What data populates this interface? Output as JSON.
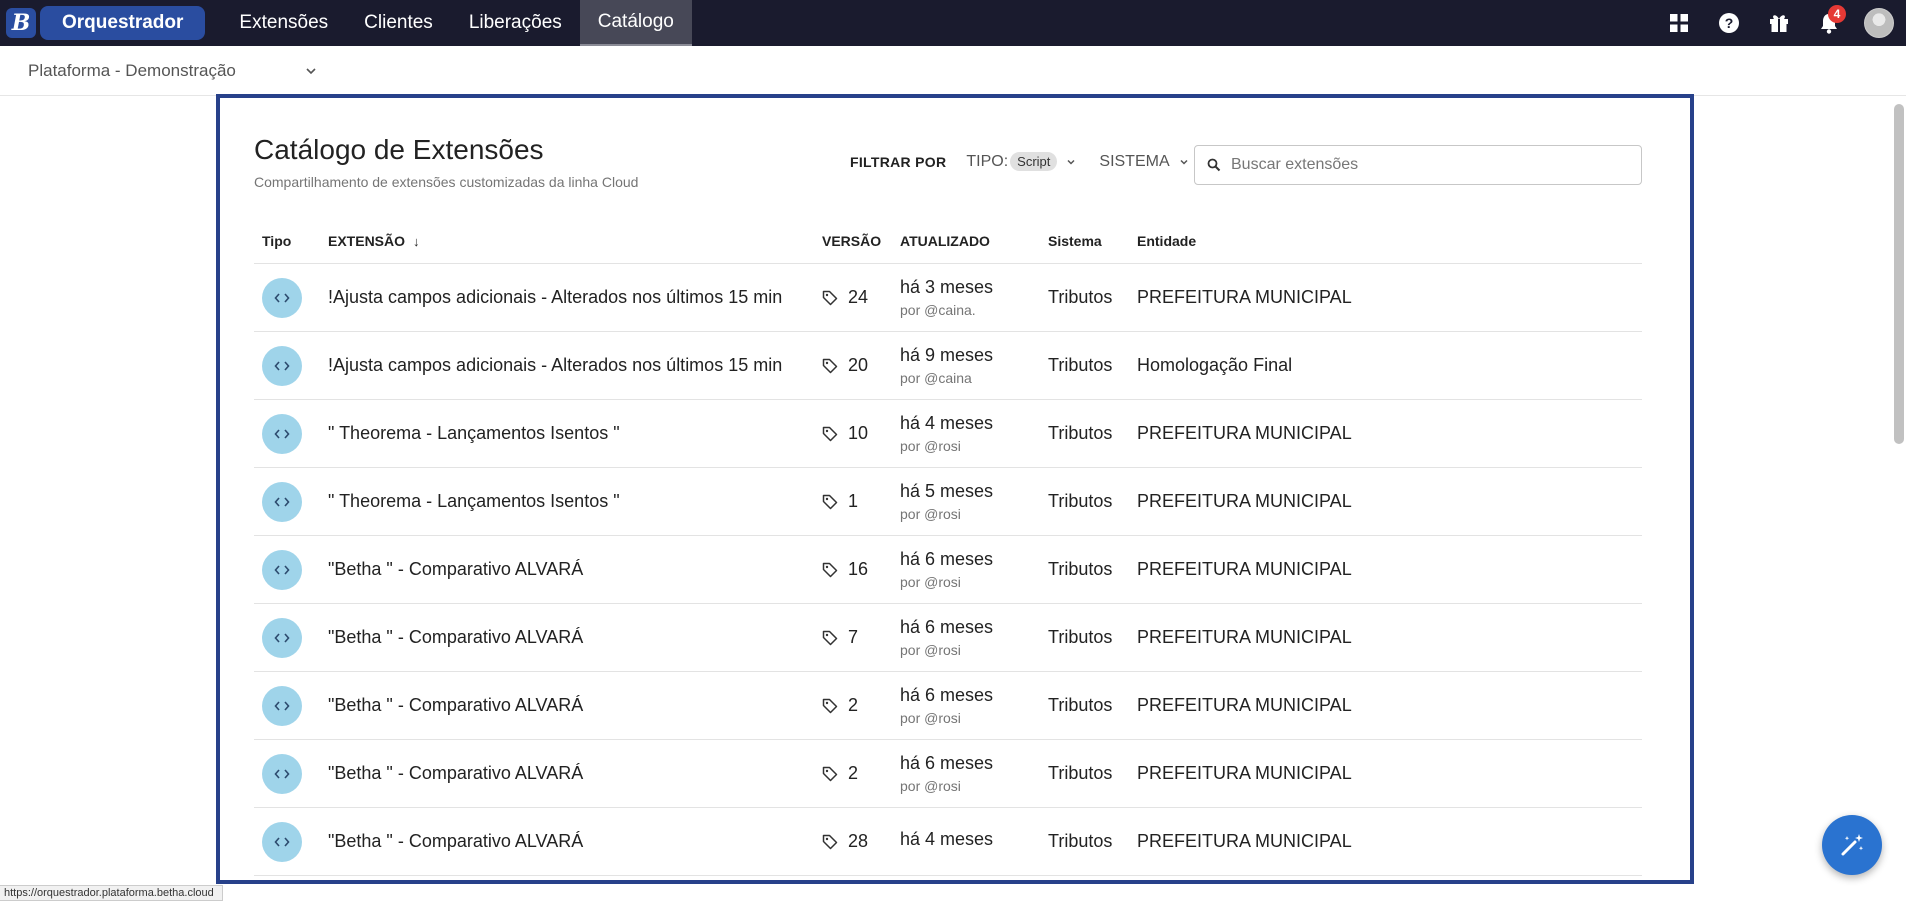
{
  "app": {
    "logo_letter": "B",
    "name": "Orquestrador"
  },
  "nav": [
    {
      "label": "Extensões",
      "active": false
    },
    {
      "label": "Clientes",
      "active": false
    },
    {
      "label": "Liberações",
      "active": false
    },
    {
      "label": "Catálogo",
      "active": true
    }
  ],
  "top_icons": {
    "apps": "grid-icon",
    "help": "help-icon",
    "gift": "gift-icon",
    "notifications": "bell-icon",
    "notification_count": "4"
  },
  "platform": {
    "selected": "Plataforma - Demonstração"
  },
  "header": {
    "title": "Catálogo de Extensões",
    "subtitle": "Compartilhamento de extensões customizadas da linha Cloud"
  },
  "filters": {
    "label": "FILTRAR POR",
    "tipo_label": "TIPO:",
    "tipo_value": "Script",
    "sistema_label": "SISTEMA"
  },
  "search": {
    "placeholder": "Buscar extensões",
    "value": ""
  },
  "table": {
    "columns": {
      "tipo": "Tipo",
      "extensao": "EXTENSÃO",
      "versao": "VERSÃO",
      "atualizado": "ATUALIZADO",
      "sistema": "Sistema",
      "entidade": "Entidade"
    },
    "rows": [
      {
        "name": "!Ajusta campos adicionais - Alterados nos últimos 15 min",
        "version": "24",
        "updated": "há 3 meses",
        "by": "por @caina.",
        "system": "Tributos",
        "entity": "PREFEITURA MUNICIPAL"
      },
      {
        "name": "!Ajusta campos adicionais - Alterados nos últimos 15 min",
        "version": "20",
        "updated": "há 9 meses",
        "by": "por @caina",
        "system": "Tributos",
        "entity": "Homologação Final"
      },
      {
        "name": "\" Theorema - Lançamentos Isentos \"",
        "version": "10",
        "updated": "há 4 meses",
        "by": "por @rosi",
        "system": "Tributos",
        "entity": "PREFEITURA MUNICIPAL"
      },
      {
        "name": "\" Theorema - Lançamentos Isentos \"",
        "version": "1",
        "updated": "há 5 meses",
        "by": "por @rosi",
        "system": "Tributos",
        "entity": "PREFEITURA MUNICIPAL"
      },
      {
        "name": "\"Betha \" - Comparativo ALVARÁ",
        "version": "16",
        "updated": "há 6 meses",
        "by": "por @rosi",
        "system": "Tributos",
        "entity": "PREFEITURA MUNICIPAL"
      },
      {
        "name": "\"Betha \" - Comparativo ALVARÁ",
        "version": "7",
        "updated": "há 6 meses",
        "by": "por @rosi",
        "system": "Tributos",
        "entity": "PREFEITURA MUNICIPAL"
      },
      {
        "name": "\"Betha \" - Comparativo ALVARÁ",
        "version": "2",
        "updated": "há 6 meses",
        "by": "por @rosi",
        "system": "Tributos",
        "entity": "PREFEITURA MUNICIPAL"
      },
      {
        "name": "\"Betha \" - Comparativo ALVARÁ",
        "version": "2",
        "updated": "há 6 meses",
        "by": "por @rosi",
        "system": "Tributos",
        "entity": "PREFEITURA MUNICIPAL"
      },
      {
        "name": "\"Betha \" - Comparativo ALVARÁ",
        "version": "28",
        "updated": "há 4 meses",
        "by": "",
        "system": "Tributos",
        "entity": "PREFEITURA MUNICIPAL"
      }
    ]
  },
  "status_url": "https://orquestrador.plataforma.betha.cloud",
  "colors": {
    "topbar": "#1a1b2e",
    "brand": "#2a4da0",
    "frame_border": "#27418a",
    "type_icon": "#9fd4ea",
    "fab": "#2a73d0",
    "badge": "#e53935"
  }
}
